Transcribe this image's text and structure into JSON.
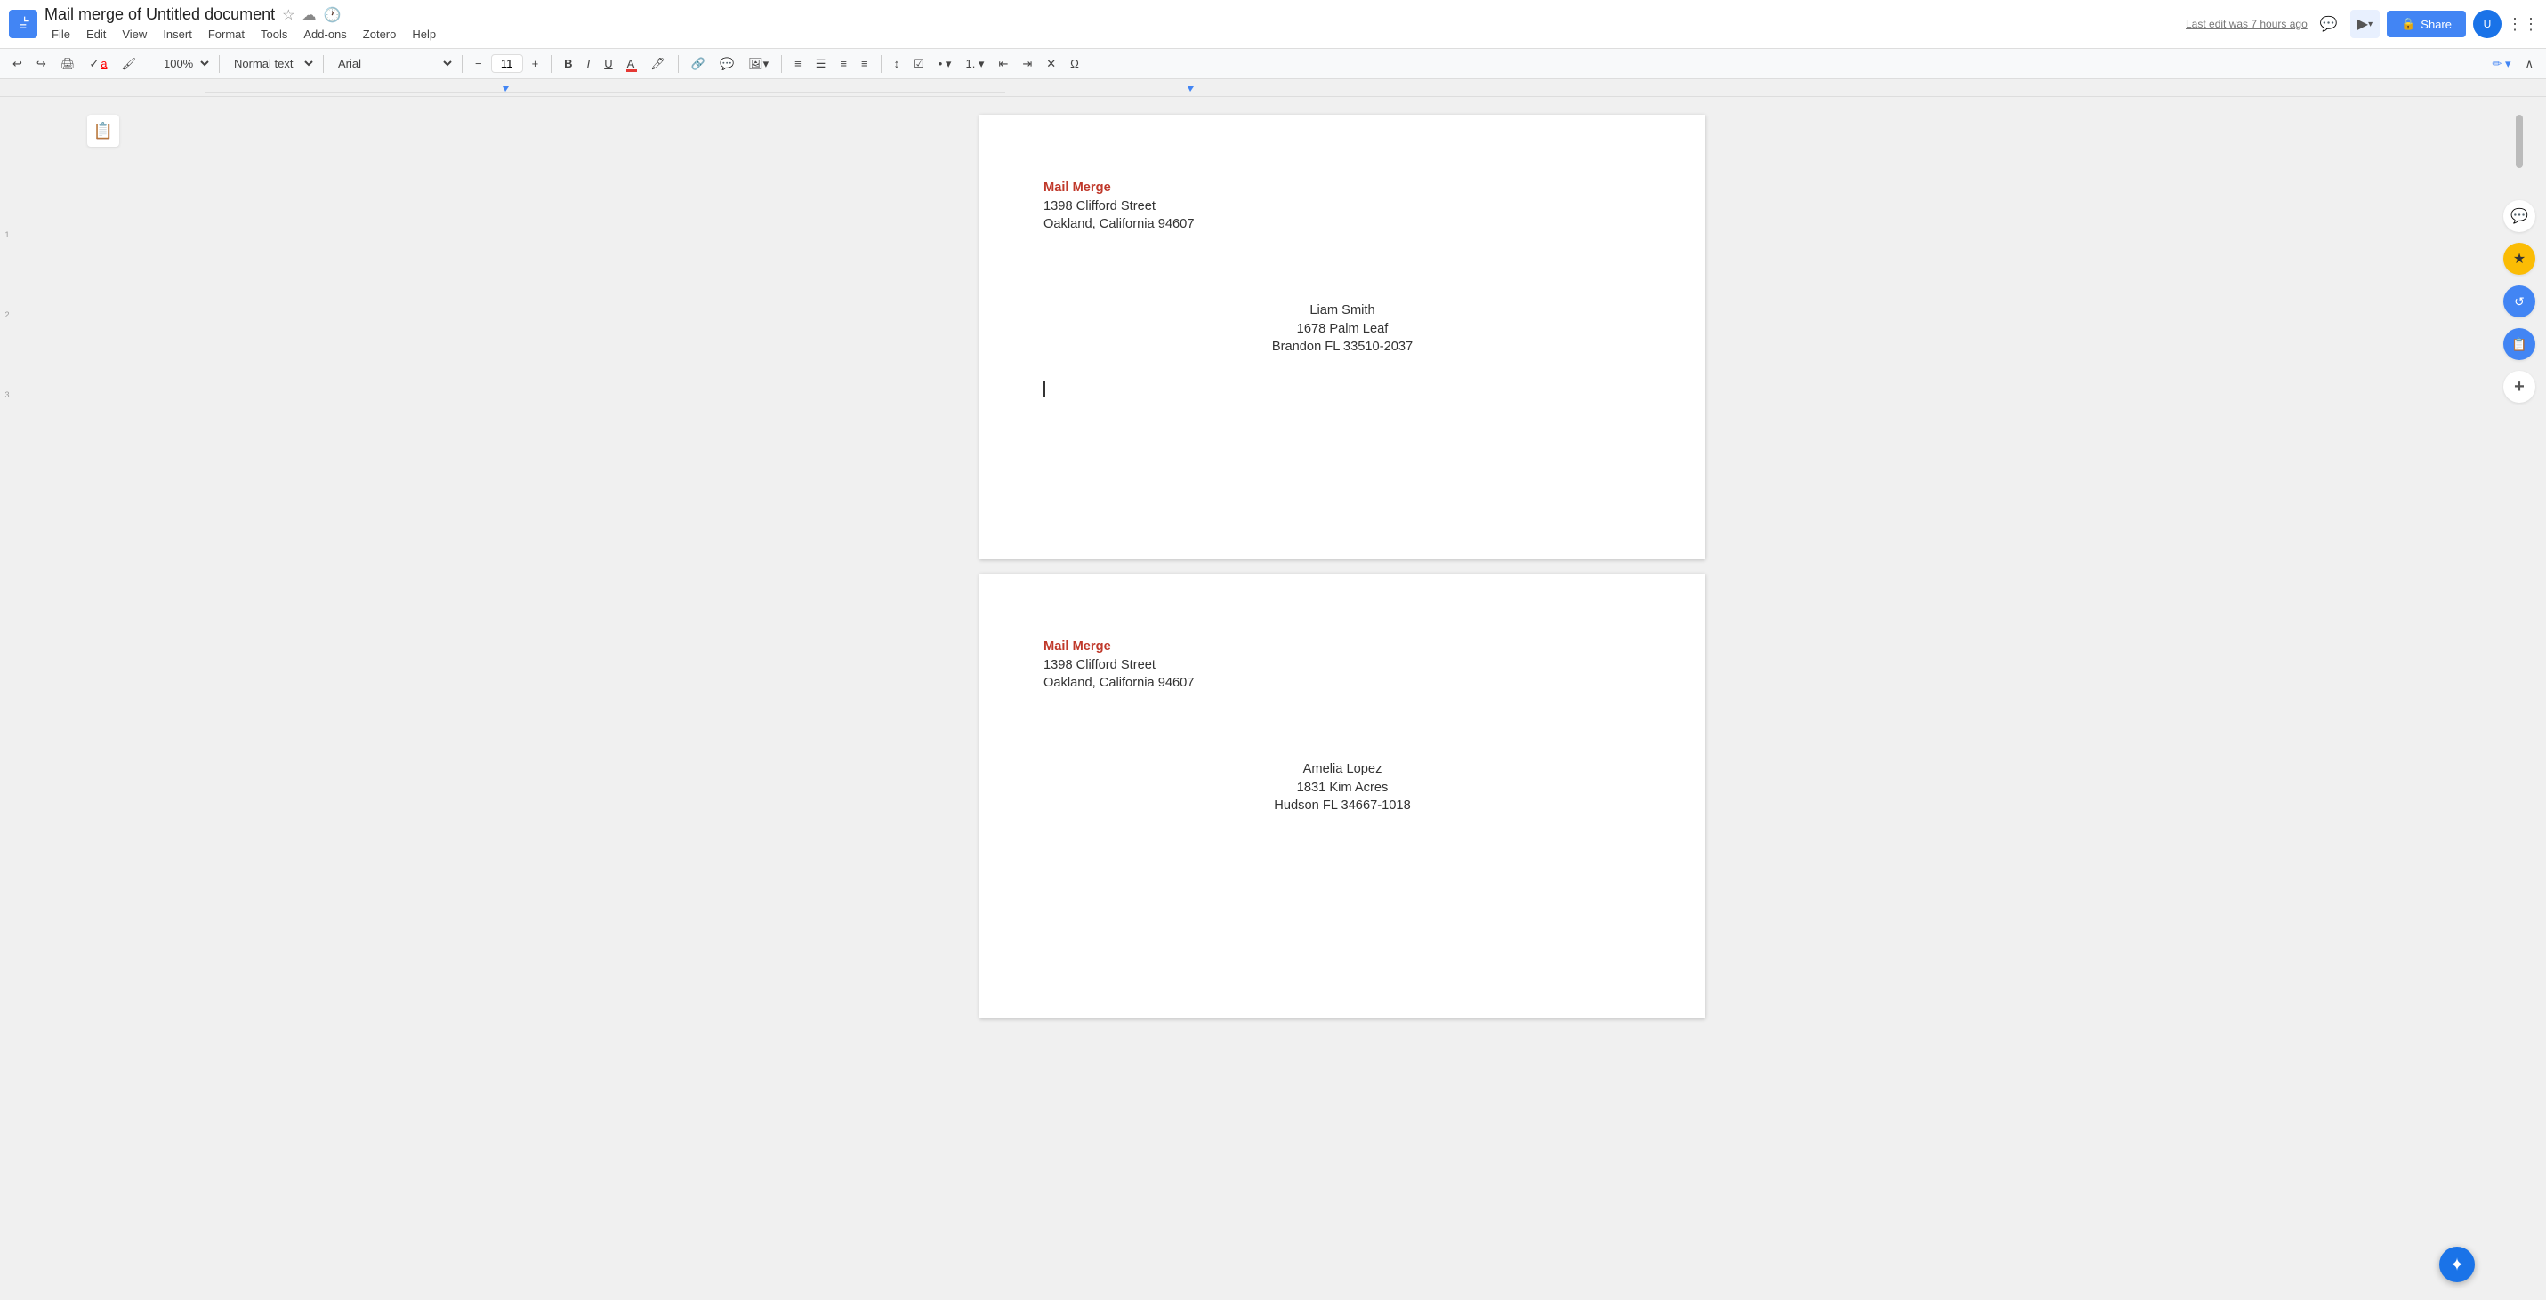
{
  "header": {
    "title": "Mail merge of Untitled document",
    "save_status": "Last edit was 7 hours ago",
    "share_label": "Share"
  },
  "menu": {
    "items": [
      "File",
      "Edit",
      "View",
      "Insert",
      "Format",
      "Tools",
      "Add-ons",
      "Zotero",
      "Help"
    ]
  },
  "toolbar": {
    "undo_label": "↩",
    "redo_label": "↪",
    "print_label": "🖨",
    "zoom_value": "100%",
    "text_style": "Normal text",
    "font_family": "Arial",
    "font_size": "11",
    "bold_label": "B",
    "italic_label": "I",
    "underline_label": "U"
  },
  "page1": {
    "sender_name": "Mail Merge",
    "sender_street": "1398 Clifford Street",
    "sender_city": "Oakland, California 94607",
    "recipient_name": "Liam Smith",
    "recipient_street": "1678 Palm Leaf",
    "recipient_city": "Brandon FL 33510-2037"
  },
  "page2": {
    "sender_name": "Mail Merge",
    "sender_street": "1398 Clifford Street",
    "sender_city": "Oakland, California 94607",
    "recipient_name": "Amelia Lopez",
    "recipient_street": "1831 Kim Acres",
    "recipient_city": "Hudson FL 34667-1018"
  },
  "icons": {
    "doc": "📄",
    "star": "☆",
    "cloud": "☁",
    "history": "🕐",
    "comment": "💬",
    "share_icon": "🔗",
    "user": "👤",
    "notes": "📋",
    "lock": "🔒",
    "plus": "+",
    "settings": "⚙",
    "circle_check": "✓",
    "expand": "⤢",
    "chevron_down": "▾",
    "minus": "−",
    "add": "+"
  },
  "right_panel": {
    "chat_icon": "💬",
    "yellow_icon": "★",
    "blue_icon": "↺",
    "blue2_icon": "📋",
    "plus_icon": "+"
  }
}
